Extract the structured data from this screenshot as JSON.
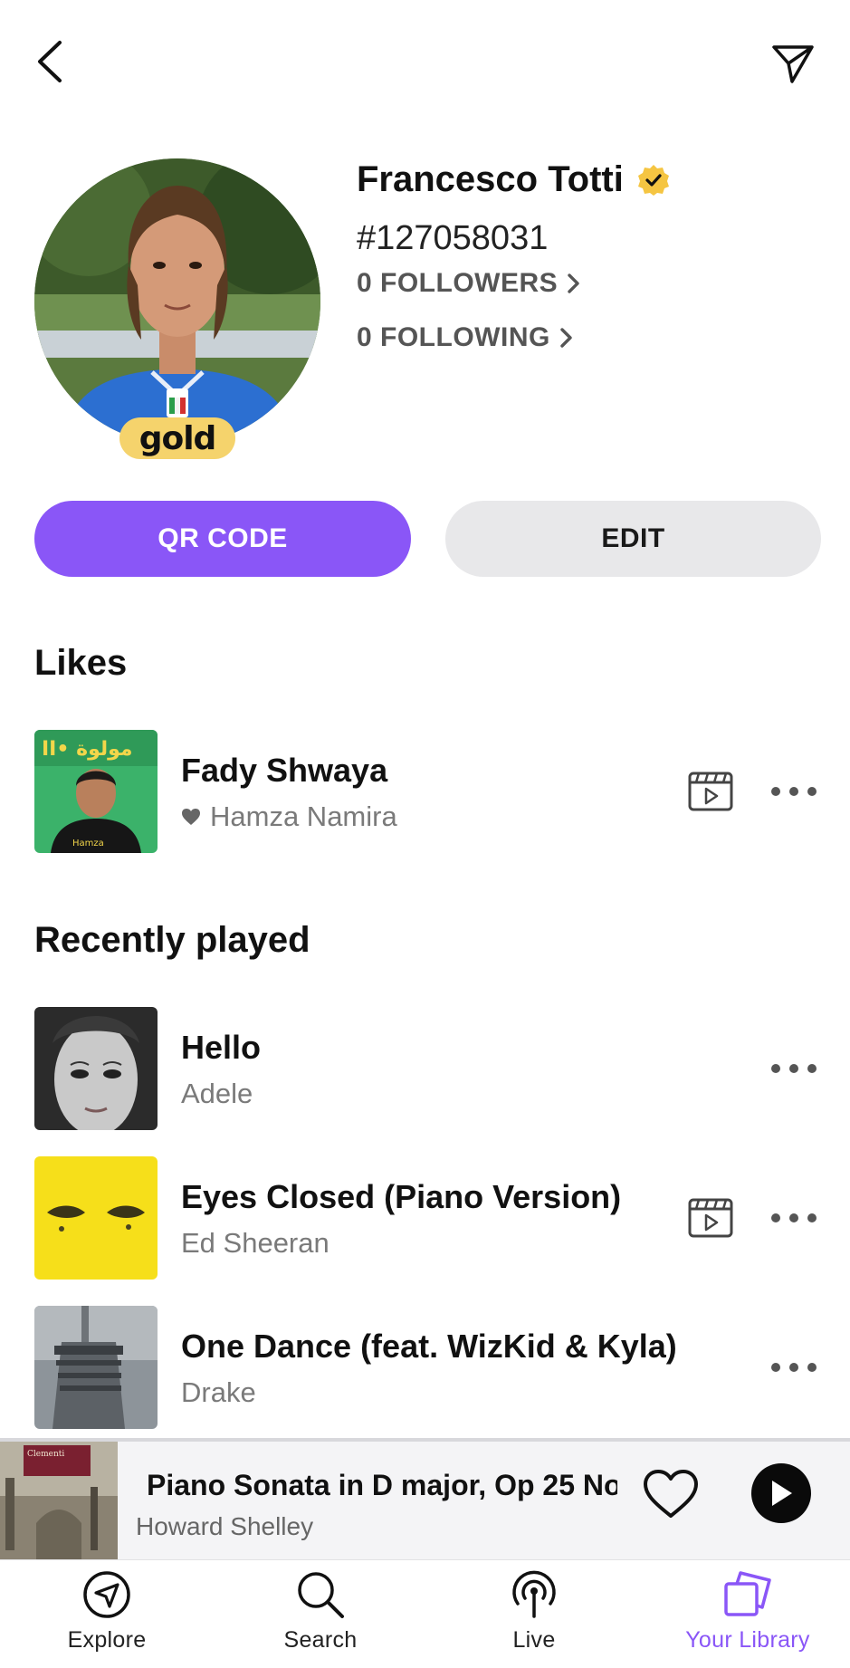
{
  "header": {
    "back_icon": "chevron-left-icon",
    "share_icon": "send-icon"
  },
  "profile": {
    "name": "Francesco Totti",
    "verified": true,
    "id": "#127058031",
    "followers_label": "0 FOLLOWERS",
    "following_label": "0 FOLLOWING",
    "badge": "gold"
  },
  "actions": {
    "qr_label": "QR CODE",
    "edit_label": "EDIT"
  },
  "likes": {
    "title": "Likes",
    "items": [
      {
        "title": "Fady Shwaya",
        "artist": "Hamza Namira",
        "has_video": true,
        "liked": true
      }
    ]
  },
  "recent": {
    "title": "Recently played",
    "items": [
      {
        "title": "Hello",
        "artist": "Adele",
        "has_video": false
      },
      {
        "title": "Eyes Closed (Piano Version)",
        "artist": "Ed Sheeran",
        "has_video": true
      },
      {
        "title": "One Dance (feat. WizKid & Kyla)",
        "artist": "Drake",
        "has_video": false
      }
    ]
  },
  "player": {
    "title": "Piano Sonata in D major, Op 25 No",
    "artist": "Howard Shelley"
  },
  "nav": {
    "items": [
      {
        "label": "Explore",
        "icon": "compass-icon",
        "active": false
      },
      {
        "label": "Search",
        "icon": "search-icon",
        "active": false
      },
      {
        "label": "Live",
        "icon": "broadcast-icon",
        "active": false
      },
      {
        "label": "Your Library",
        "icon": "library-icon",
        "active": true
      }
    ]
  },
  "colors": {
    "accent": "#8a56f7",
    "gold": "#f5d36c",
    "muted_text": "#7a7a7a"
  }
}
